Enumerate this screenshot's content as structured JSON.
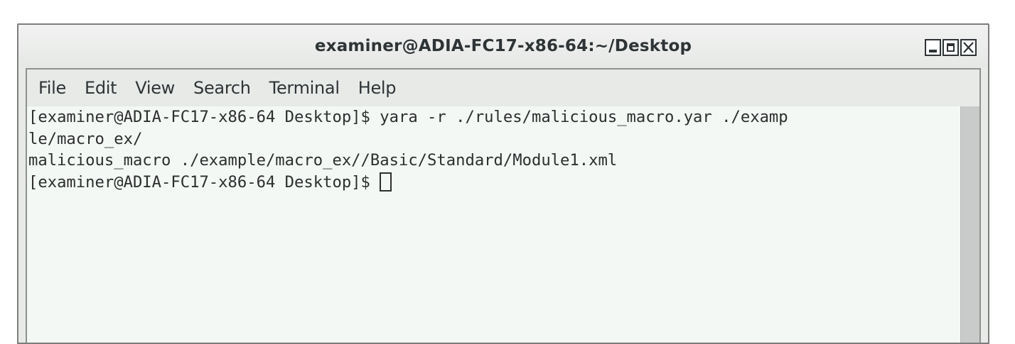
{
  "window": {
    "title": "examiner@ADIA-FC17-x86-64:~/Desktop"
  },
  "menubar": {
    "items": [
      "File",
      "Edit",
      "View",
      "Search",
      "Terminal",
      "Help"
    ]
  },
  "terminal": {
    "lines": [
      "[examiner@ADIA-FC17-x86-64 Desktop]$ yara -r ./rules/malicious_macro.yar ./examp",
      "le/macro_ex/",
      "malicious_macro ./example/macro_ex//Basic/Standard/Module1.xml",
      "[examiner@ADIA-FC17-x86-64 Desktop]$ "
    ]
  },
  "icons": {
    "minimize": "minimize-icon",
    "maximize": "maximize-icon",
    "close": "close-icon"
  }
}
